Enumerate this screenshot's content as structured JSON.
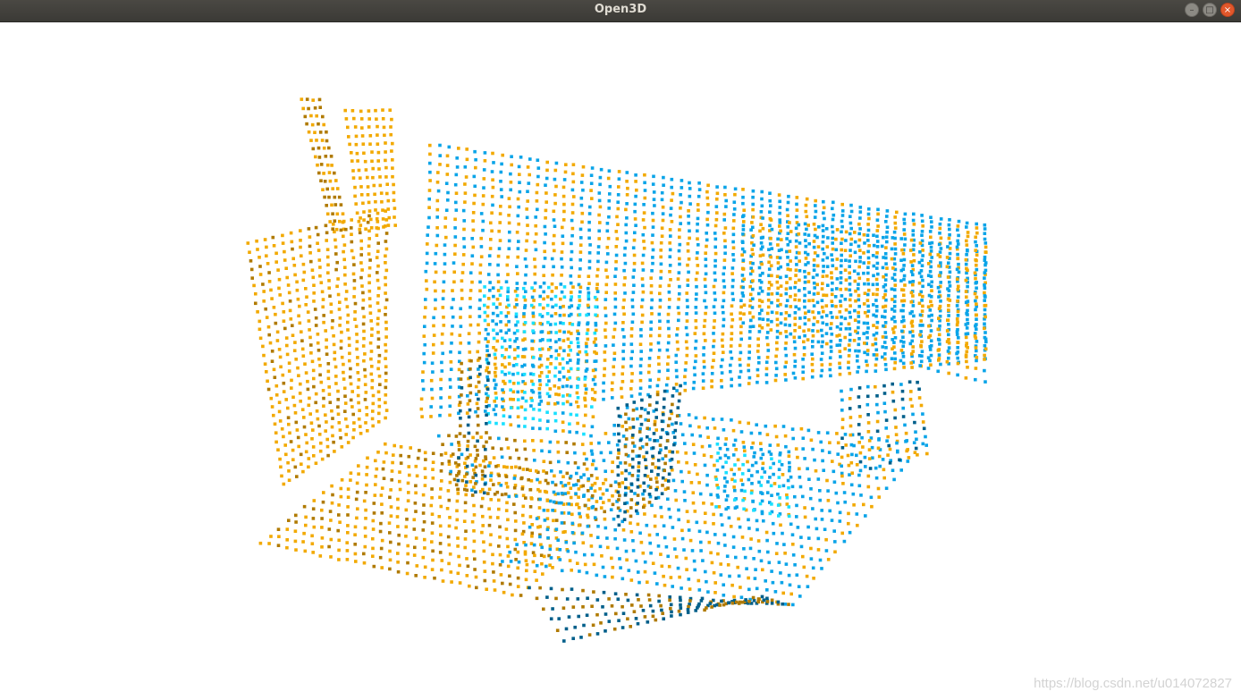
{
  "window": {
    "title": "Open3D",
    "buttons": {
      "minimize_icon": "minimize-icon",
      "maximize_icon": "maximize-icon",
      "close_icon": "close-icon"
    }
  },
  "viewport": {
    "background": "#ffffff",
    "point_colors": {
      "source_cloud": "#f2a900",
      "source_cloud_shadow": "#b07a00",
      "target_cloud": "#0aa4e8",
      "target_cloud_shadow": "#005f8a",
      "highlight": "#19e0ff"
    }
  },
  "watermark": "https://blog.csdn.net/u014072827"
}
